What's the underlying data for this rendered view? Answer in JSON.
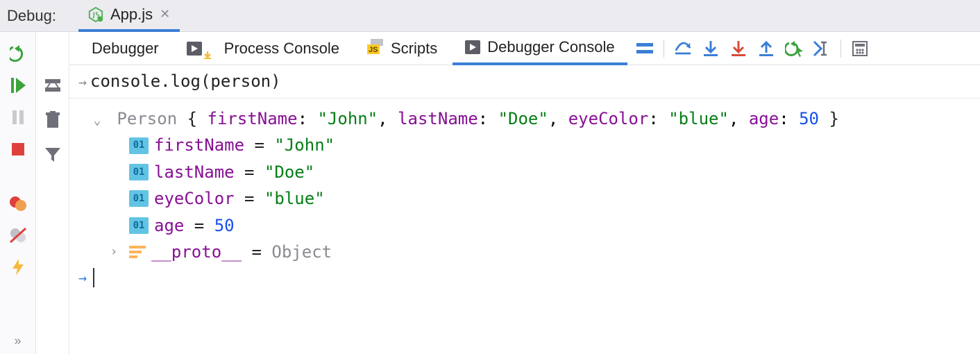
{
  "topbar": {
    "label": "Debug:",
    "file_tab": {
      "name": "App.js"
    }
  },
  "left_controls": {
    "rerun": "rerun",
    "resume": "resume",
    "pause": "pause",
    "stop": "stop",
    "breakpoints": "breakpoints",
    "mute_breakpoints": "mute-breakpoints",
    "power": "power"
  },
  "second_controls": {
    "layout": "layout",
    "trash": "trash",
    "filter": "filter"
  },
  "inner_tabs": {
    "debugger": "Debugger",
    "process_console": "Process Console",
    "scripts": "Scripts",
    "debugger_console": "Debugger Console"
  },
  "toolbar": {
    "stack": "stack",
    "step_over": "step-over",
    "step_into": "step-into",
    "force_step_into": "force-step-into",
    "step_out": "step-out",
    "run_to_cursor": "run-to-cursor",
    "evaluate": "evaluate",
    "calc": "calc"
  },
  "console": {
    "command": "console.log(person)",
    "object": {
      "class_name": "Person ",
      "header": {
        "open": "{",
        "keys": [
          "firstName",
          "lastName",
          "eyeColor",
          "age"
        ],
        "sep": ": ",
        "comma": ", ",
        "close": "}"
      },
      "props": [
        {
          "name": "firstName",
          "value": "\"John\"",
          "type": "str"
        },
        {
          "name": "lastName",
          "value": "\"Doe\"",
          "type": "str"
        },
        {
          "name": "eyeColor",
          "value": "\"blue\"",
          "type": "str"
        },
        {
          "name": "age",
          "value": "50",
          "type": "num"
        }
      ],
      "proto": {
        "name": "__proto__",
        "value": "Object"
      },
      "eq": " = ",
      "badge": "01"
    }
  }
}
